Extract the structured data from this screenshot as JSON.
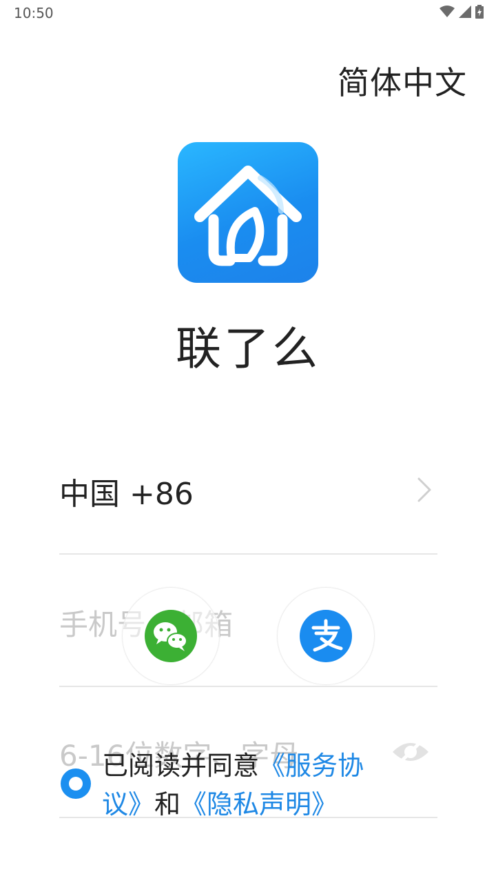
{
  "status_bar": {
    "time": "10:50",
    "icons": [
      "wifi-icon",
      "signal-icon",
      "battery-icon"
    ]
  },
  "header": {
    "language": "简体中文"
  },
  "app": {
    "name": "联了么",
    "logo_icon": "house-leaf-logo",
    "brand_color": "#1a8df0"
  },
  "login_form": {
    "country_code": "中国 +86",
    "phone_placeholder": "手机号、邮箱",
    "password_placeholder": "6-16位数字、字母"
  },
  "social_login": {
    "wechat_icon": "wechat-icon",
    "alipay_icon": "alipay-icon",
    "wechat_color": "#3cb034",
    "alipay_color": "#1a8cf0"
  },
  "agreement": {
    "prefix": "已阅读并同意",
    "service_link": "《服务协议》",
    "conjunction": "和",
    "privacy_link": "《隐私声明》"
  }
}
